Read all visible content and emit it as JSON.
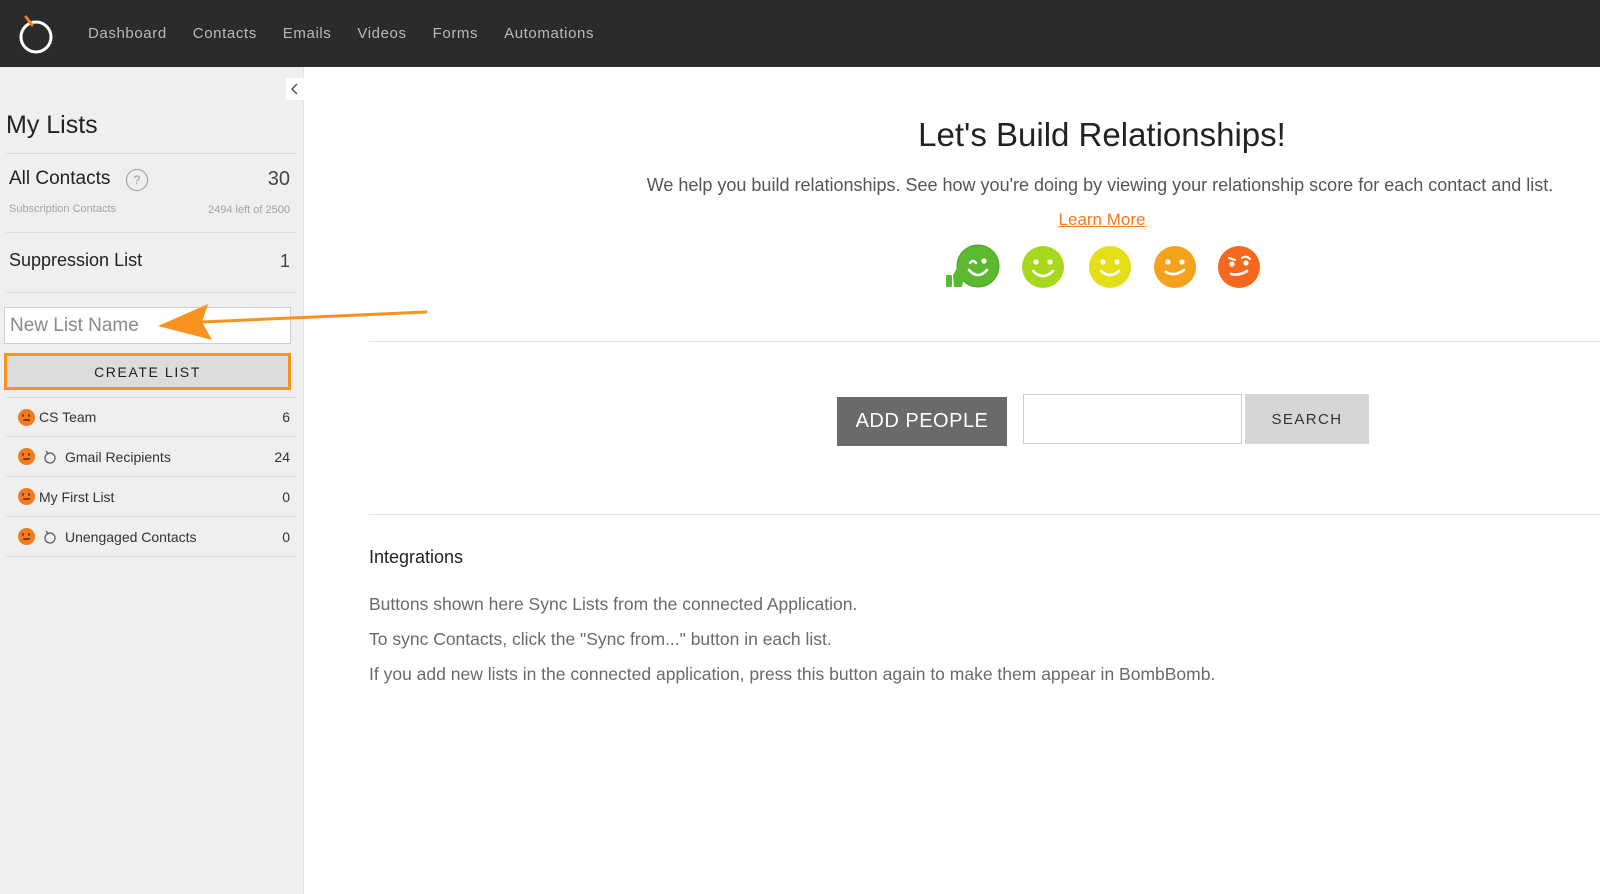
{
  "nav": {
    "items": [
      "Dashboard",
      "Contacts",
      "Emails",
      "Videos",
      "Forms",
      "Automations"
    ]
  },
  "sidebar": {
    "title": "My Lists",
    "all_contacts": {
      "label": "All Contacts",
      "help": "?",
      "count": "30",
      "subtitle": "Subscription Contacts",
      "quota": "2494 left of 2500"
    },
    "suppression": {
      "label": "Suppression List",
      "count": "1"
    },
    "new_list_placeholder": "New List Name",
    "create_label": "CREATE LIST",
    "lists": [
      {
        "name": "CS Team",
        "count": "6",
        "synced": false
      },
      {
        "name": "Gmail Recipients",
        "count": "24",
        "synced": true
      },
      {
        "name": "My First List",
        "count": "0",
        "synced": false
      },
      {
        "name": "Unengaged Contacts",
        "count": "0",
        "synced": true
      }
    ]
  },
  "main": {
    "title": "Let's Build Relationships!",
    "subtitle": "We help you build relationships. See how you're doing by viewing your relationship score for each contact and list.",
    "learn_more": "Learn More",
    "add_people": "ADD PEOPLE",
    "search_label": "SEARCH",
    "integrations_title": "Integrations",
    "integrations_lines": [
      "Buttons shown here Sync Lists from the connected Application.",
      "To sync Contacts, click the \"Sync from...\" button in each list.",
      "If you add new lists in the connected application, press this button again to make them appear in BombBomb."
    ]
  },
  "colors": {
    "accent": "#f47a20",
    "highlight": "#f7931e",
    "score_faces": [
      "#5cb82f",
      "#a6d81e",
      "#e3de18",
      "#f5a21d",
      "#f4691e"
    ]
  }
}
